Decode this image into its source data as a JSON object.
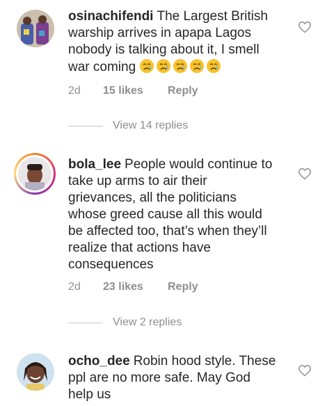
{
  "comments": [
    {
      "username": "osinachifendi",
      "text": "The Largest British warship arrives in apapa Lagos nobody is talking about it, I smell war coming",
      "emojis": [
        "crying-face",
        "crying-face",
        "crying-face",
        "crying-face",
        "crying-face"
      ],
      "time": "2d",
      "likes": "15 likes",
      "reply": "Reply",
      "view_replies": "View 14 replies"
    },
    {
      "username": "bola_lee",
      "text": "People would continue to take up arms to air their grievances, all the politicians whose greed cause all this would be affected too, that’s when they’ll realize that actions have consequences",
      "time": "2d",
      "likes": "23 likes",
      "reply": "Reply",
      "view_replies": "View 2 replies"
    },
    {
      "username": "ocho_dee",
      "text": "Robin hood style. These ppl are no more safe. May God help us"
    }
  ],
  "colors": {
    "text": "#262626",
    "secondary": "#8e8e8e",
    "story_ring": "#dd2a7b"
  },
  "icons": {
    "like": "heart-outline-icon"
  }
}
